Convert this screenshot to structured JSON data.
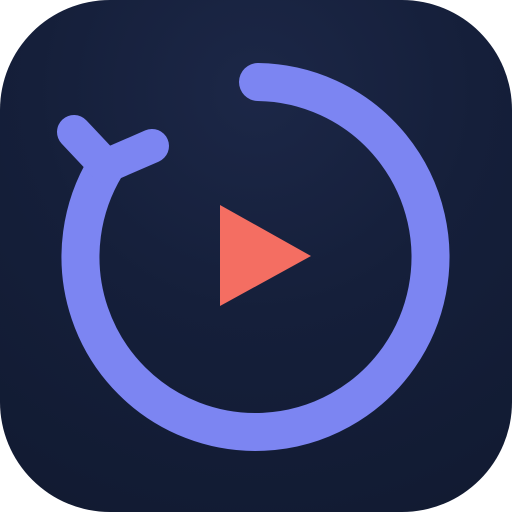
{
  "app_icon": {
    "name": "timer-play-app-icon",
    "icon_semantics": [
      "stopwatch-icon",
      "play-icon"
    ],
    "colors": {
      "background": "#151f3a",
      "ring": "#7c85f2",
      "play": "#f46e62"
    }
  }
}
